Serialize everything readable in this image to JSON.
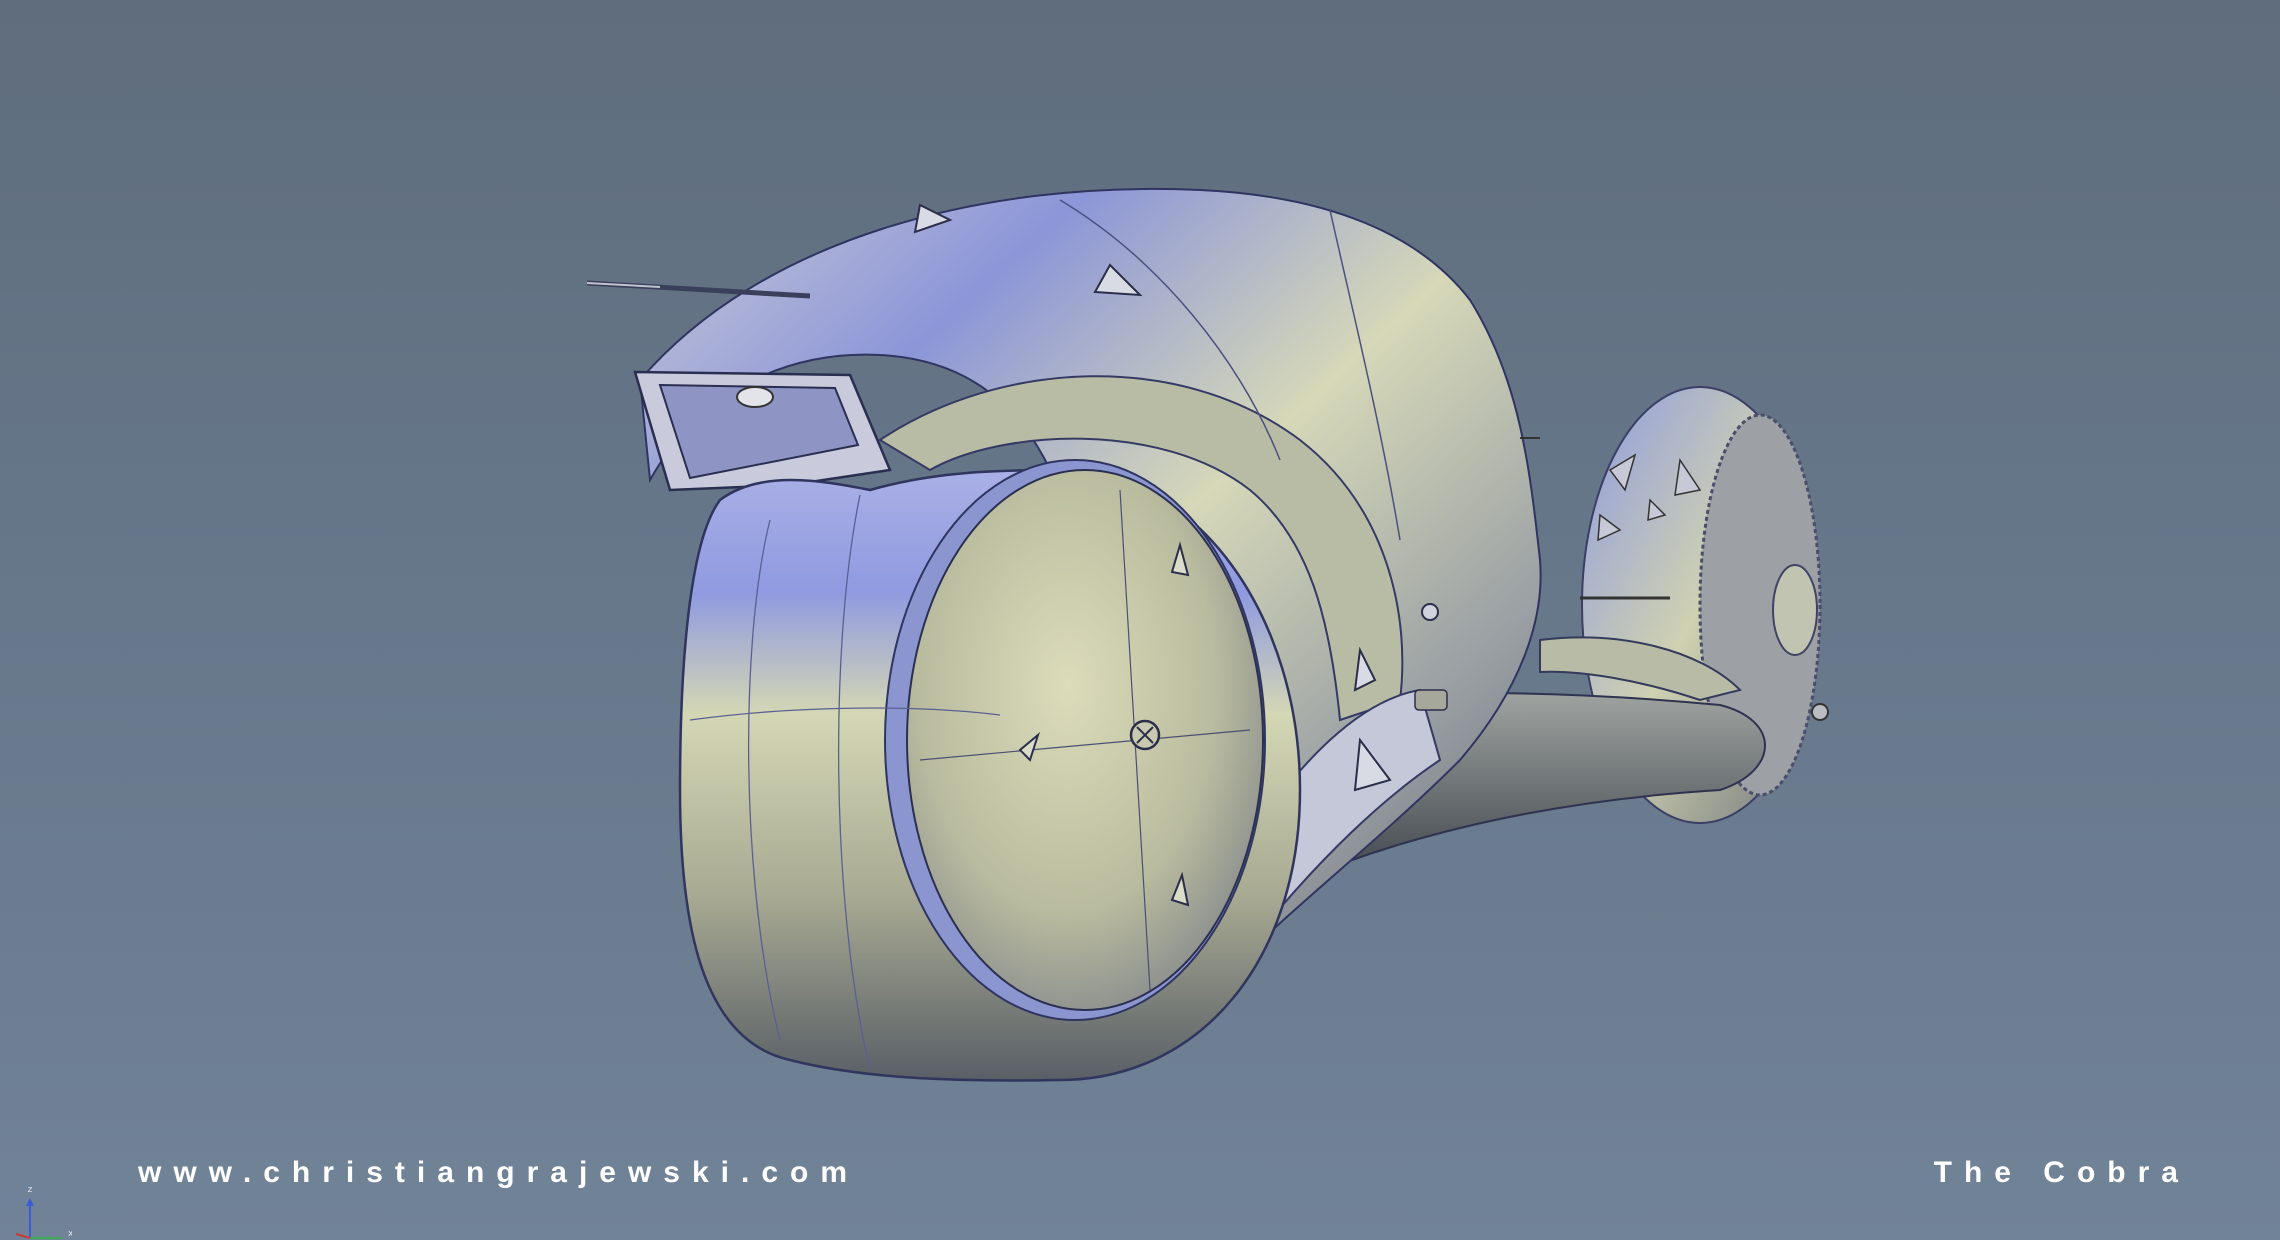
{
  "website_caption": "www.christiangrajewski.com",
  "title_caption": "The Cobra",
  "axis_gizmo": {
    "z_label": "z",
    "x_label": "x"
  },
  "colors": {
    "background_top": "#5f6d7c",
    "background_bottom": "#718398",
    "body_highlight": "#d8dab6",
    "body_reflection": "#6f7fe0",
    "caption_text": "#ffffff"
  }
}
